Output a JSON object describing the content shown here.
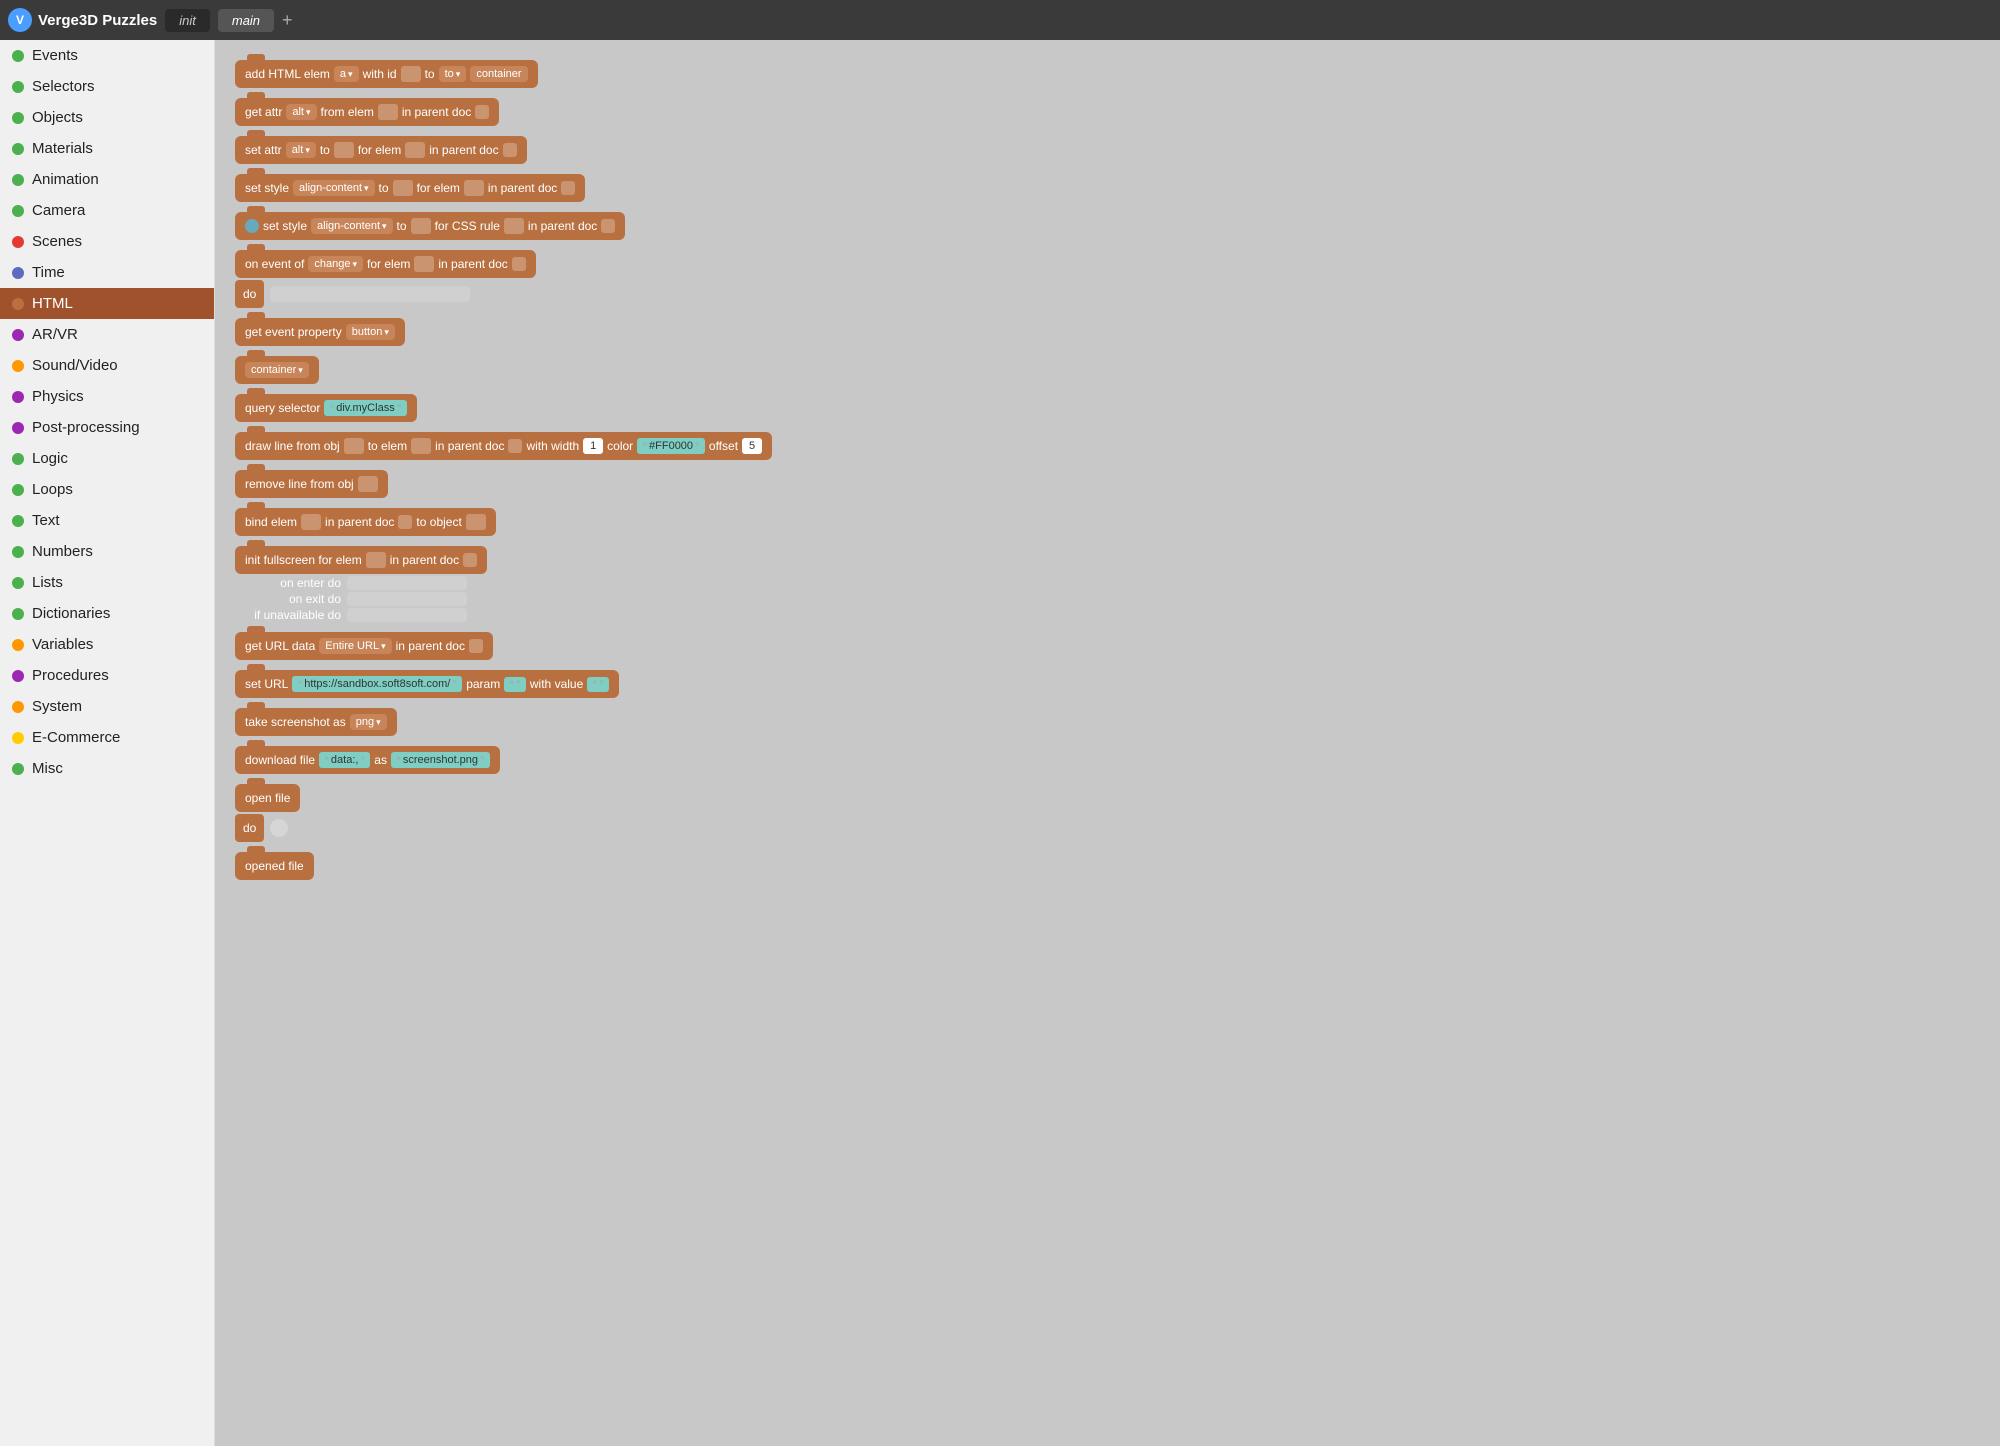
{
  "header": {
    "logo_text": "Verge3D Puzzles",
    "logo_icon": "V",
    "tab_init": "init",
    "tab_main": "main",
    "add_tab_label": "+"
  },
  "sidebar": {
    "items": [
      {
        "id": "events",
        "label": "Events",
        "color": "#4caf50",
        "active": false
      },
      {
        "id": "selectors",
        "label": "Selectors",
        "color": "#4caf50",
        "active": false
      },
      {
        "id": "objects",
        "label": "Objects",
        "color": "#4caf50",
        "active": false
      },
      {
        "id": "materials",
        "label": "Materials",
        "color": "#4caf50",
        "active": false
      },
      {
        "id": "animation",
        "label": "Animation",
        "color": "#4caf50",
        "active": false
      },
      {
        "id": "camera",
        "label": "Camera",
        "color": "#4caf50",
        "active": false
      },
      {
        "id": "scenes",
        "label": "Scenes",
        "color": "#e53935",
        "active": false
      },
      {
        "id": "time",
        "label": "Time",
        "color": "#5c6bc0",
        "active": false
      },
      {
        "id": "html",
        "label": "HTML",
        "color": "#b97040",
        "active": true
      },
      {
        "id": "arvr",
        "label": "AR/VR",
        "color": "#9c27b0",
        "active": false
      },
      {
        "id": "soundvideo",
        "label": "Sound/Video",
        "color": "#ff9800",
        "active": false
      },
      {
        "id": "physics",
        "label": "Physics",
        "color": "#9c27b0",
        "active": false
      },
      {
        "id": "postprocessing",
        "label": "Post-processing",
        "color": "#9c27b0",
        "active": false
      },
      {
        "id": "logic",
        "label": "Logic",
        "color": "#4caf50",
        "active": false
      },
      {
        "id": "loops",
        "label": "Loops",
        "color": "#4caf50",
        "active": false
      },
      {
        "id": "text",
        "label": "Text",
        "color": "#4caf50",
        "active": false
      },
      {
        "id": "numbers",
        "label": "Numbers",
        "color": "#4caf50",
        "active": false
      },
      {
        "id": "lists",
        "label": "Lists",
        "color": "#4caf50",
        "active": false
      },
      {
        "id": "dictionaries",
        "label": "Dictionaries",
        "color": "#4caf50",
        "active": false
      },
      {
        "id": "variables",
        "label": "Variables",
        "color": "#ff9800",
        "active": false
      },
      {
        "id": "procedures",
        "label": "Procedures",
        "color": "#9c27b0",
        "active": false
      },
      {
        "id": "system",
        "label": "System",
        "color": "#ff9800",
        "active": false
      },
      {
        "id": "ecommerce",
        "label": "E-Commerce",
        "color": "#ffcc00",
        "active": false
      },
      {
        "id": "misc",
        "label": "Misc",
        "color": "#4caf50",
        "active": false
      }
    ]
  },
  "blocks": {
    "add_html_elem": "add HTML elem",
    "with_id": "with id",
    "to": "to",
    "container_val": "container",
    "get_attr": "get attr",
    "from_elem": "from elem",
    "in_parent_doc": "in parent doc",
    "set_attr": "set attr",
    "for_elem": "for elem",
    "set_style": "set style",
    "for_css_rule": "for CSS rule",
    "on_event_of": "on event of",
    "do": "do",
    "get_event_property": "get event property",
    "container_chip": "container",
    "query_selector": "query selector",
    "div_myClass": "div.myClass",
    "draw_line": "draw line from obj",
    "to_elem": "to elem",
    "with_width": "with width",
    "color": "color",
    "offset": "offset",
    "hex_color": "#FF0000",
    "remove_line": "remove line from obj",
    "bind_elem": "bind elem",
    "in_parent_doc2": "in parent doc",
    "to_object": "to object",
    "init_fullscreen": "init fullscreen for elem",
    "on_enter_do": "on enter do",
    "on_exit_do": "on exit do",
    "if_unavailable_do": "if unavailable do",
    "get_url_data": "get URL data",
    "entire_url": "Entire URL",
    "in_parent_doc3": "in parent doc",
    "set_url": "set URL",
    "url_value": "https://sandbox.soft8soft.com/",
    "param": "param",
    "with_value": "with value",
    "take_screenshot": "take screenshot as",
    "png": "png",
    "download_file": "download file",
    "data_prefix": "data:,",
    "as": "as",
    "screenshot_filename": "screenshot.png",
    "open_file": "open file",
    "opened_file": "opened file",
    "alt_chip": "alt",
    "change_chip": "change",
    "button_chip": "button",
    "align_content_chip": "align-content",
    "a_chip": "a",
    "num_1": "1",
    "num_5": "5"
  }
}
